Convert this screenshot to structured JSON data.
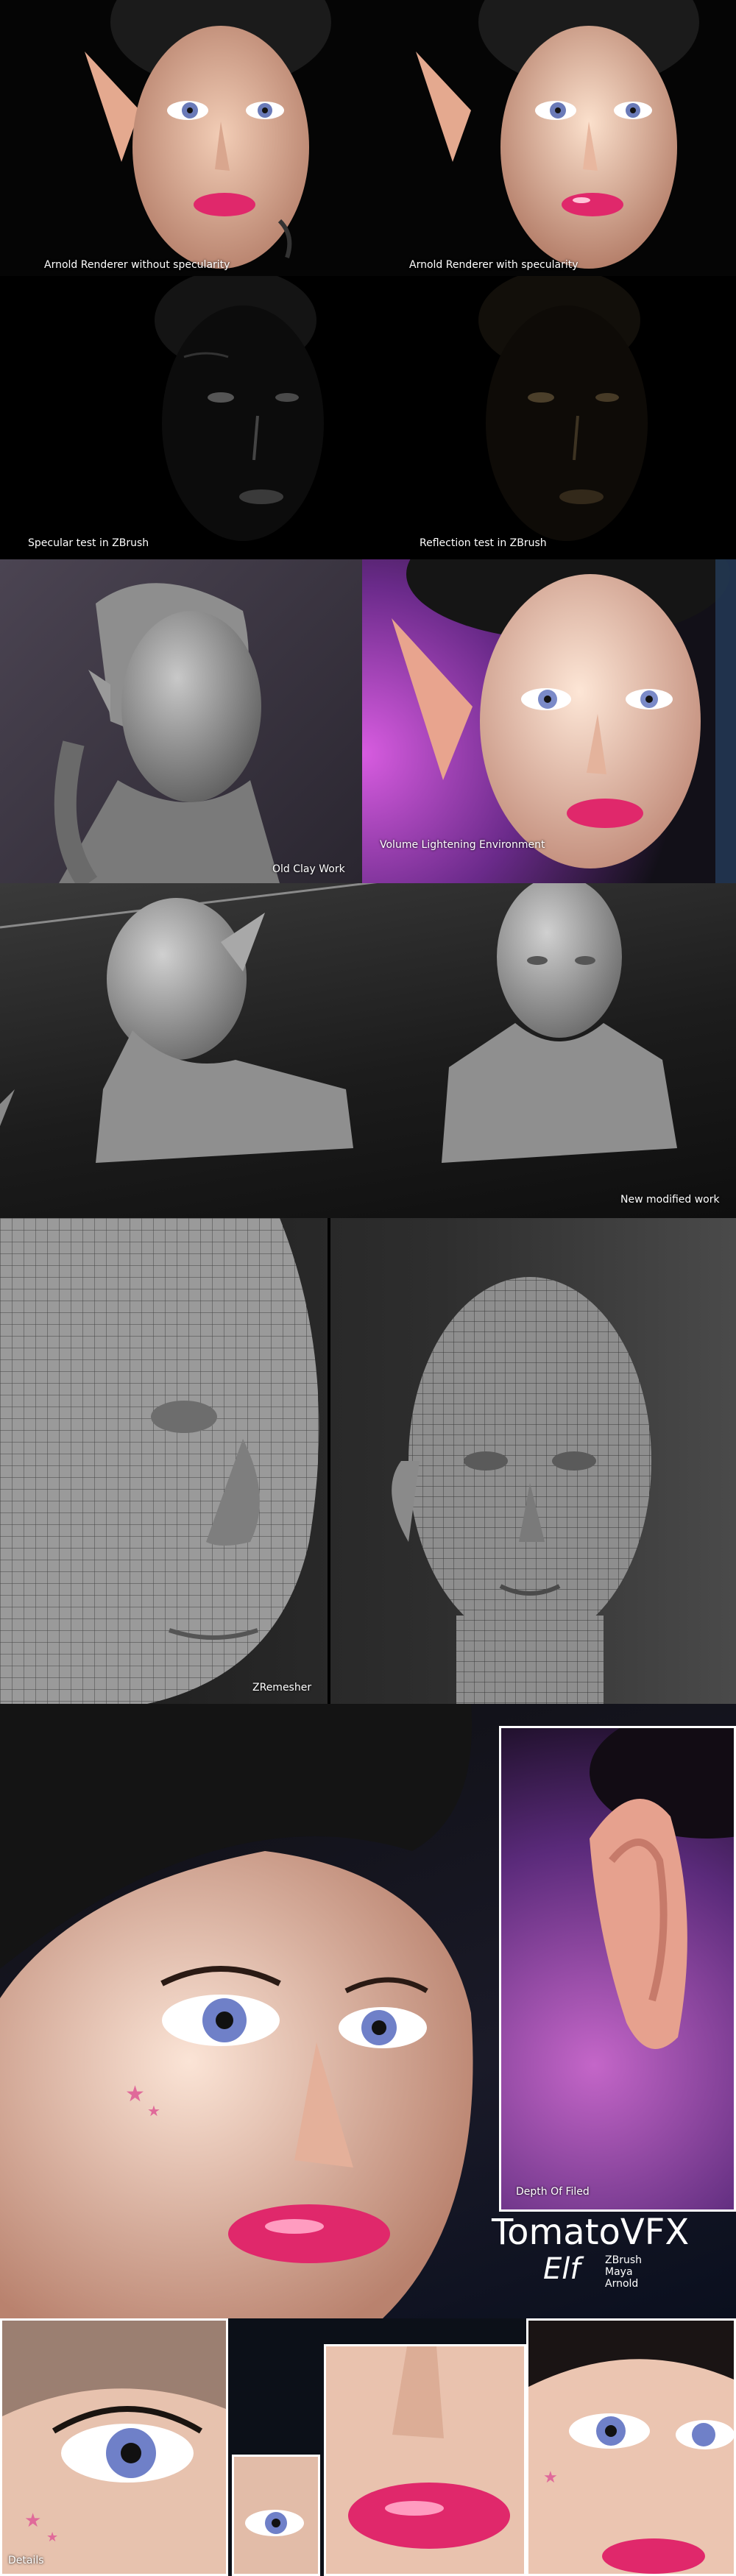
{
  "row1": {
    "left_caption": "Arnold Renderer without specularity",
    "right_caption": "Arnold Renderer with specularity"
  },
  "row2": {
    "left_caption": "Specular test in ZBrush",
    "right_caption": "Reflection test in ZBrush"
  },
  "row3": {
    "left_caption": "Old Clay Work",
    "right_caption": "Volume Lightening Environment"
  },
  "row4": {
    "caption": "New modified work"
  },
  "row5": {
    "caption": "ZRemesher"
  },
  "row6": {
    "inset_caption": "Depth Of Filed",
    "brand": "TomatoVFX",
    "project": "Elf",
    "tools": [
      "ZBrush",
      "Maya",
      "Arnold"
    ]
  },
  "row7": {
    "caption": "Details"
  },
  "colors": {
    "background": "#000000",
    "lip_pink": "#e0286b",
    "skin": "#e8b8a0",
    "clay_grey": "#8c8c8c",
    "purple_bg": "#b040c0"
  }
}
